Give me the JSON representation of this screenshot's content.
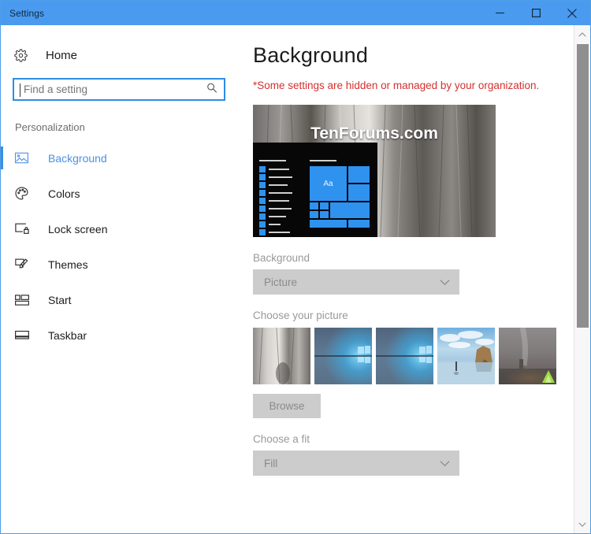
{
  "window": {
    "title": "Settings",
    "titlebar_color": "#4a9bf0",
    "controls": {
      "minimize": "Minimize",
      "maximize": "Maximize",
      "close": "Close"
    }
  },
  "sidebar": {
    "home_label": "Home",
    "home_icon": "gear-icon",
    "search": {
      "placeholder": "Find a setting",
      "value": "",
      "icon": "search-icon"
    },
    "section_label": "Personalization",
    "items": [
      {
        "label": "Background",
        "icon": "picture-icon",
        "selected": true
      },
      {
        "label": "Colors",
        "icon": "palette-icon",
        "selected": false
      },
      {
        "label": "Lock screen",
        "icon": "lock-screen-icon",
        "selected": false
      },
      {
        "label": "Themes",
        "icon": "themes-icon",
        "selected": false
      },
      {
        "label": "Start",
        "icon": "start-tiles-icon",
        "selected": false
      },
      {
        "label": "Taskbar",
        "icon": "taskbar-icon",
        "selected": false
      }
    ],
    "accent_color": "#3b8fe0"
  },
  "main": {
    "page_title": "Background",
    "warning_text": "*Some settings are hidden or managed by your organization.",
    "warning_color": "#d53030",
    "preview": {
      "watermark": "TenForums.com",
      "tile_text": "Aa",
      "tile_color": "#2f92ef"
    },
    "background_section": {
      "label": "Background",
      "value": "Picture",
      "disabled": true,
      "chevron": "chevron-down-icon"
    },
    "picture_section": {
      "label": "Choose your picture",
      "thumbnails": [
        {
          "name": "rock-wall-grey",
          "c1": "#b9b7b4",
          "c2": "#6f6d6b"
        },
        {
          "name": "windows-hero-1",
          "c1": "#5c7186",
          "c2": "#2aa8e8"
        },
        {
          "name": "windows-hero-2",
          "c1": "#5c7186",
          "c2": "#2aa8e8"
        },
        {
          "name": "beach-rock-arch",
          "c1": "#9cc6e4",
          "c2": "#c6a66f"
        },
        {
          "name": "night-sky-tent",
          "c1": "#8f8a88",
          "c2": "#6d6663"
        }
      ],
      "browse_label": "Browse",
      "browse_disabled": true
    },
    "fit_section": {
      "label": "Choose a fit",
      "value": "Fill",
      "disabled": true,
      "chevron": "chevron-down-icon"
    }
  },
  "scrollbar": {
    "up_arrow": "chevron-up-icon",
    "down_arrow": "chevron-down-icon",
    "thumb_position": "top"
  }
}
